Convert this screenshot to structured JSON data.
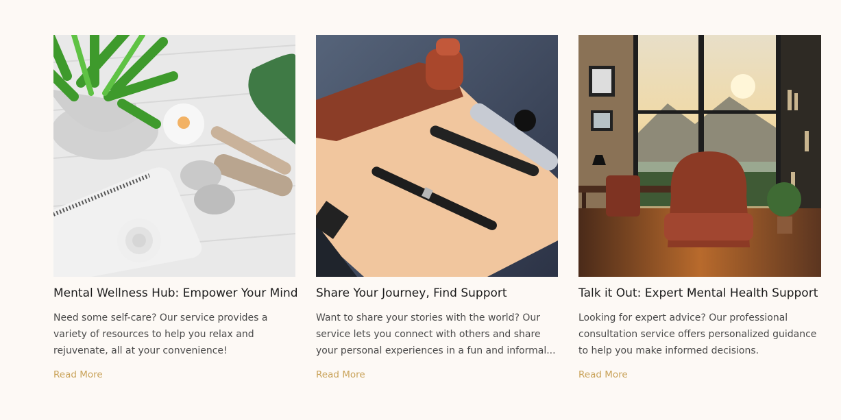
{
  "colors": {
    "background": "#fdf9f5",
    "title": "#1c1c1c",
    "body_text": "#4a4a4a",
    "accent": "#c9a35a"
  },
  "cards": [
    {
      "image": "wellness-still-life-image",
      "title": "Mental Wellness Hub: Empower Your Mind",
      "description": "Need some self-care? Our service provides a variety of resources to help you relax and rejuvenate, all at your convenience!",
      "link_label": "Read More"
    },
    {
      "image": "pen-and-paper-image",
      "title": "Share Your Journey, Find Support",
      "description": "Want to share your stories with the world? Our service lets you connect with others and share your personal experiences in a fun and informal...",
      "link_label": "Read More"
    },
    {
      "image": "consultation-room-image",
      "title": "Talk it Out: Expert Mental Health Support",
      "description": "Looking for expert advice? Our professional consultation service offers personalized guidance to help you make informed decisions.",
      "link_label": "Read More"
    }
  ]
}
